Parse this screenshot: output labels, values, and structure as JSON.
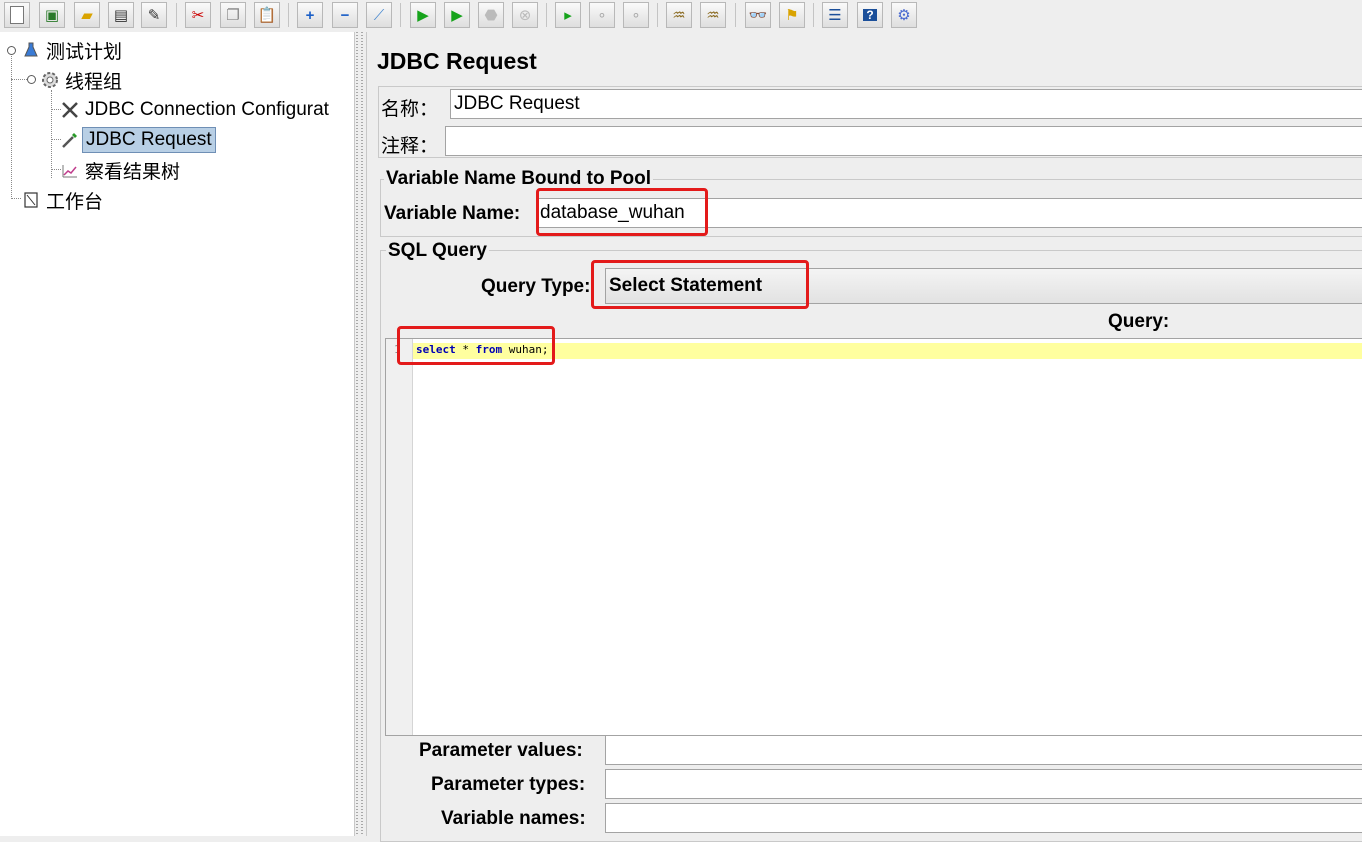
{
  "tree": {
    "nodes": [
      {
        "label": "测试计划",
        "icon": "test-plan-flask-icon"
      },
      {
        "label": "线程组",
        "icon": "thread-group-gear-icon"
      },
      {
        "label": "JDBC Connection Configurat",
        "icon": "wrench-screwdriver-icon"
      },
      {
        "label": "JDBC Request",
        "icon": "sampler-pipette-icon"
      },
      {
        "label": "察看结果树",
        "icon": "results-graph-icon"
      },
      {
        "label": "工作台",
        "icon": "workbench-icon"
      }
    ]
  },
  "panel": {
    "title": "JDBC Request",
    "name_label": "名称：",
    "name_value": "JDBC Request",
    "comment_label": "注释：",
    "comment_value": "",
    "pool_group_title": "Variable Name Bound to Pool",
    "variable_name_label": "Variable Name:",
    "variable_name_value": "database_wuhan",
    "sql_group_title": "SQL Query",
    "query_type_label": "Query Type:",
    "query_type_value": "Select Statement",
    "query_label": "Query:",
    "code_line_number": "1",
    "code_kw1": "select",
    "code_mid": " * ",
    "code_kw2": "from",
    "code_tail": " wuhan;",
    "param_values_label": "Parameter values:",
    "param_types_label": "Parameter types:",
    "variable_names_label": "Variable names:",
    "param_values_value": "",
    "param_types_value": "",
    "variable_names_value": ""
  },
  "toolbar": {
    "buttons": [
      "new-icon",
      "templates-icon",
      "open-icon",
      "save-icon",
      "save-as-icon",
      "cut-icon",
      "copy-icon",
      "paste-icon",
      "expand-icon",
      "collapse-icon",
      "toggle-icon",
      "start-icon",
      "start-no-pause-icon",
      "stop-icon",
      "shutdown-icon",
      "remote-start-icon",
      "remote-stop-icon",
      "remote-shutdown-icon",
      "clear-icon",
      "clear-all-icon",
      "search-binoculars-icon",
      "reset-search-broom-icon",
      "function-helper-icon",
      "help-icon",
      "log-viewer-icon"
    ]
  },
  "colors": {
    "highlight": "#e31a1a",
    "selection": "#b8cfe5",
    "current_line": "#ffff9f"
  }
}
